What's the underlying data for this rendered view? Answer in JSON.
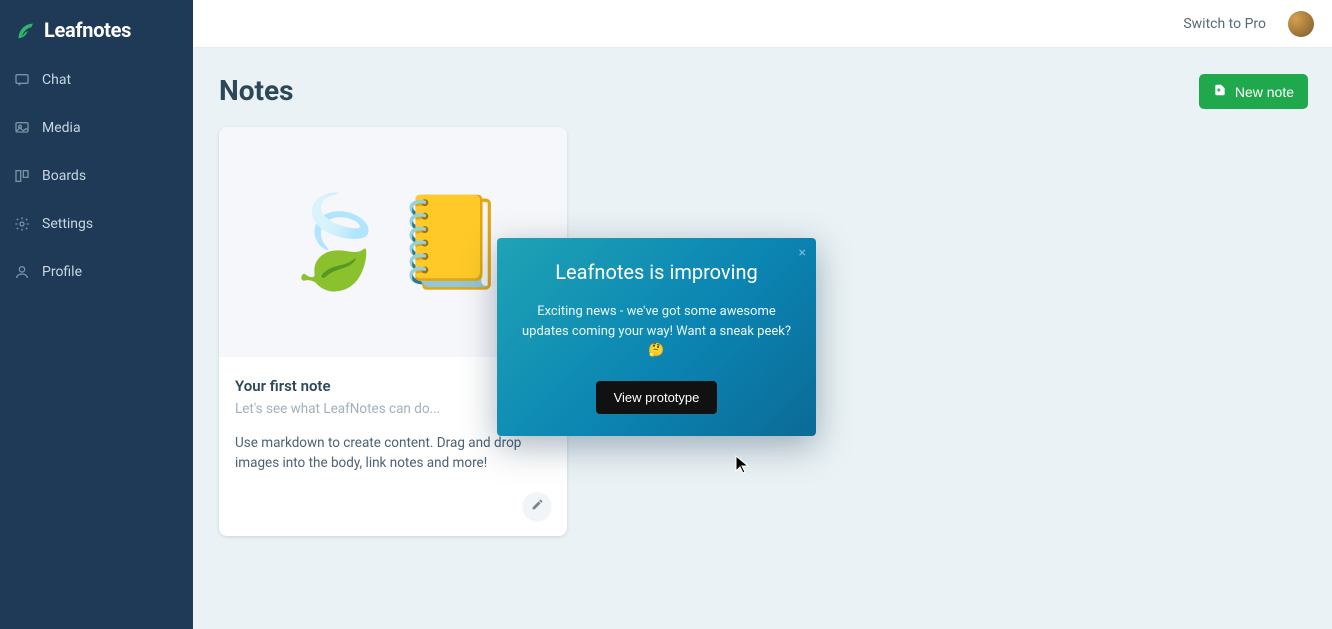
{
  "brand": {
    "name": "Leafnotes"
  },
  "sidebar": {
    "items": [
      {
        "label": "Chat"
      },
      {
        "label": "Media"
      },
      {
        "label": "Boards"
      },
      {
        "label": "Settings"
      },
      {
        "label": "Profile"
      }
    ]
  },
  "header": {
    "switch_pro": "Switch to Pro"
  },
  "page": {
    "title": "Notes",
    "new_note_label": "New note"
  },
  "note_card": {
    "title": "Your first note",
    "subtitle": "Let's see what LeafNotes can do...",
    "description": "Use markdown to create content. Drag and drop images into the body, link notes and more!",
    "emoji_leaves": "🍃",
    "emoji_notebook": "📒"
  },
  "modal": {
    "title": "Leafnotes is improving",
    "text": "Exciting news - we've got some awesome updates coming your way! Want a sneak peek? 🤔",
    "button": "View prototype"
  }
}
